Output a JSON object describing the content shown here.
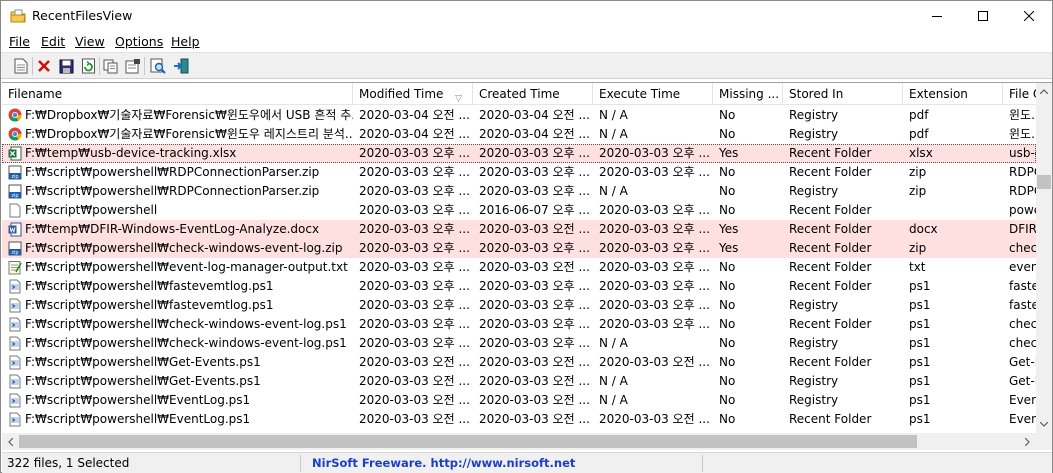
{
  "window": {
    "title": "RecentFilesView"
  },
  "menu": [
    {
      "label": "File"
    },
    {
      "label": "Edit"
    },
    {
      "label": "View"
    },
    {
      "label": "Options"
    },
    {
      "label": "Help"
    }
  ],
  "toolbar": {
    "buttons": [
      {
        "name": "html-report-icon"
      },
      {
        "name": "delete-icon"
      },
      {
        "name": "save-icon"
      },
      {
        "name": "refresh-icon"
      },
      {
        "name": "copy-icon"
      },
      {
        "name": "properties-icon"
      },
      {
        "name": "find-icon"
      },
      {
        "name": "exit-icon"
      }
    ]
  },
  "columns": [
    {
      "label": "Filename"
    },
    {
      "label": "Modified Time",
      "sorted": true
    },
    {
      "label": "Created Time"
    },
    {
      "label": "Execute Time"
    },
    {
      "label": "Missing ..."
    },
    {
      "label": "Stored In"
    },
    {
      "label": "Extension"
    },
    {
      "label": "File O"
    }
  ],
  "rows": [
    {
      "icon": "chrome",
      "state": "",
      "cells": [
        "F:₩Dropbox₩기술자료₩Forensic₩윈도우에서 USB 흔적 추...",
        "2020-03-04 오전 ...",
        "2020-03-04 오전 ...",
        "N / A",
        "No",
        "Registry",
        "pdf",
        "윈도..."
      ]
    },
    {
      "icon": "chrome",
      "state": "",
      "cells": [
        "F:₩Dropbox₩기술자료₩Forensic₩윈도우 레지스트리 분석...",
        "2020-03-04 오전 ...",
        "2020-03-04 오전 ...",
        "N / A",
        "No",
        "Registry",
        "pdf",
        "윈도..."
      ]
    },
    {
      "icon": "excel",
      "state": "selected",
      "cells": [
        "F:₩temp₩usb-device-tracking.xlsx",
        "2020-03-03 오후 ...",
        "2020-03-03 오후 ...",
        "2020-03-03 오후 ...",
        "Yes",
        "Recent Folder",
        "xlsx",
        "usb-d"
      ]
    },
    {
      "icon": "zip",
      "state": "",
      "cells": [
        "F:₩script₩powershell₩RDPConnectionParser.zip",
        "2020-03-03 오후 ...",
        "2020-03-03 오후 ...",
        "2020-03-03 오후 ...",
        "No",
        "Recent Folder",
        "zip",
        "RDPC"
      ]
    },
    {
      "icon": "zip",
      "state": "",
      "cells": [
        "F:₩script₩powershell₩RDPConnectionParser.zip",
        "2020-03-03 오후 ...",
        "2020-03-03 오후 ...",
        "N / A",
        "No",
        "Registry",
        "zip",
        "RDPC"
      ]
    },
    {
      "icon": "blank",
      "state": "",
      "cells": [
        "F:₩script₩powershell",
        "2020-03-03 오후 ...",
        "2016-06-07 오후 ...",
        "2020-03-03 오후 ...",
        "No",
        "Recent Folder",
        "",
        "powe"
      ]
    },
    {
      "icon": "word",
      "state": "missing",
      "cells": [
        "F:₩temp₩DFIR-Windows-EventLog-Analyze.docx",
        "2020-03-03 오후 ...",
        "2020-03-03 오전 ...",
        "2020-03-03 오후 ...",
        "Yes",
        "Recent Folder",
        "docx",
        "DFIR"
      ]
    },
    {
      "icon": "zip",
      "state": "missing",
      "cells": [
        "F:₩script₩powershell₩check-windows-event-log.zip",
        "2020-03-03 오후 ...",
        "2020-03-03 오후 ...",
        "2020-03-03 오후 ...",
        "Yes",
        "Recent Folder",
        "zip",
        "chec"
      ]
    },
    {
      "icon": "text",
      "state": "",
      "cells": [
        "F:₩script₩powershell₩event-log-manager-output.txt",
        "2020-03-03 오후 ...",
        "2020-03-03 오전 ...",
        "2020-03-03 오후 ...",
        "No",
        "Recent Folder",
        "txt",
        "event"
      ]
    },
    {
      "icon": "ps1",
      "state": "",
      "cells": [
        "F:₩script₩powershell₩fastevemtlog.ps1",
        "2020-03-03 오후 ...",
        "2020-03-03 오후 ...",
        "2020-03-03 오후 ...",
        "No",
        "Recent Folder",
        "ps1",
        "faste"
      ]
    },
    {
      "icon": "ps1",
      "state": "",
      "cells": [
        "F:₩script₩powershell₩fastevemtlog.ps1",
        "2020-03-03 오후 ...",
        "2020-03-03 오후 ...",
        "2020-03-03 오후 ...",
        "No",
        "Registry",
        "ps1",
        "faste"
      ]
    },
    {
      "icon": "ps1",
      "state": "",
      "cells": [
        "F:₩script₩powershell₩check-windows-event-log.ps1",
        "2020-03-03 오후 ...",
        "2020-03-03 오후 ...",
        "2020-03-03 오후 ...",
        "No",
        "Recent Folder",
        "ps1",
        "chec"
      ]
    },
    {
      "icon": "ps1",
      "state": "",
      "cells": [
        "F:₩script₩powershell₩check-windows-event-log.ps1",
        "2020-03-03 오후 ...",
        "2020-03-03 오후 ...",
        "N / A",
        "No",
        "Registry",
        "ps1",
        "chec"
      ]
    },
    {
      "icon": "ps1",
      "state": "",
      "cells": [
        "F:₩script₩powershell₩Get-Events.ps1",
        "2020-03-03 오전 ...",
        "2020-03-03 오전 ...",
        "2020-03-03 오전 ...",
        "No",
        "Recent Folder",
        "ps1",
        "Get-E"
      ]
    },
    {
      "icon": "ps1",
      "state": "",
      "cells": [
        "F:₩script₩powershell₩Get-Events.ps1",
        "2020-03-03 오전 ...",
        "2020-03-03 오전 ...",
        "N / A",
        "No",
        "Registry",
        "ps1",
        "Get-E"
      ]
    },
    {
      "icon": "ps1",
      "state": "",
      "cells": [
        "F:₩script₩powershell₩EventLog.ps1",
        "2020-03-03 오전 ...",
        "2020-03-03 오전 ...",
        "N / A",
        "No",
        "Registry",
        "ps1",
        "Event"
      ]
    },
    {
      "icon": "ps1",
      "state": "",
      "cells": [
        "F:₩script₩powershell₩EventLog.ps1",
        "2020-03-03 오전 ...",
        "2020-03-03 오전 ...",
        "2020-03-03 오전 ...",
        "No",
        "Recent Folder",
        "ps1",
        "Event"
      ]
    }
  ],
  "status": {
    "count_text": "322 files, 1 Selected",
    "link_text": "NirSoft Freeware.  http://www.nirsoft.net"
  },
  "colors": {
    "missing_row": "#ffe0e0",
    "link": "#1a3fc8"
  }
}
